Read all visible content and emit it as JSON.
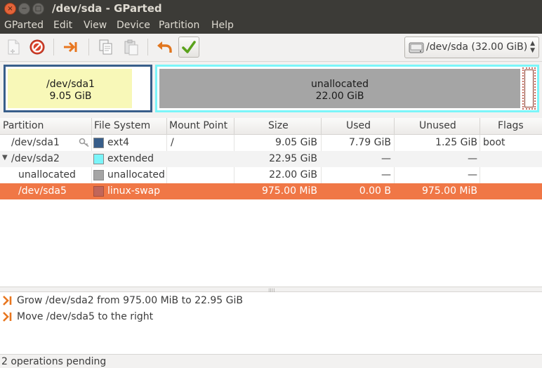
{
  "window": {
    "title": "/dev/sda - GParted"
  },
  "window_controls": {
    "close": "×",
    "minimize": "−",
    "maximize": "□"
  },
  "menu": [
    "GParted",
    "Edit",
    "View",
    "Device",
    "Partition",
    "Help"
  ],
  "device": {
    "label": "/dev/sda  (32.00 GiB)"
  },
  "map": {
    "sda1": {
      "name": "/dev/sda1",
      "size": "9.05 GiB",
      "used_fraction": 0.86
    },
    "unallocated": {
      "name": "unallocated",
      "size": "22.00 GiB"
    }
  },
  "table": {
    "columns": [
      "Partition",
      "File System",
      "Mount Point",
      "Size",
      "Used",
      "Unused",
      "Flags"
    ],
    "rows": [
      {
        "partition": "/dev/sda1",
        "filesystem": "ext4",
        "fs_color": "#385e8a",
        "mount": "/",
        "size": "9.05 GiB",
        "used": "7.79 GiB",
        "unused": "1.25 GiB",
        "flags": "boot"
      },
      {
        "partition": "/dev/sda2",
        "filesystem": "extended",
        "fs_color": "#7bf5f9",
        "mount": "",
        "size": "22.95 GiB",
        "used": "—",
        "unused": "—",
        "flags": ""
      },
      {
        "partition": "unallocated",
        "filesystem": "unallocated",
        "fs_color": "#a5a5a5",
        "mount": "",
        "size": "22.00 GiB",
        "used": "—",
        "unused": "—",
        "flags": ""
      },
      {
        "partition": "/dev/sda5",
        "filesystem": "linux-swap",
        "fs_color": "#c1665a",
        "mount": "",
        "size": "975.00 MiB",
        "used": "0.00 B",
        "unused": "975.00 MiB",
        "flags": ""
      }
    ]
  },
  "operations": [
    "Grow /dev/sda2 from 975.00 MiB to 22.95 GiB",
    "Move /dev/sda5 to the right"
  ],
  "status": "2 operations pending",
  "colors": {
    "selection": "#f07746",
    "ext4": "#385e8a",
    "extended": "#7bf5f9",
    "unallocated": "#a5a5a5",
    "linux_swap": "#c1665a",
    "used_fill": "#f8f8b8"
  },
  "icons": [
    "new-icon",
    "delete-icon",
    "resize-move-icon",
    "copy-icon",
    "paste-icon",
    "undo-icon",
    "apply-icon",
    "harddisk-icon",
    "operation-icon",
    "lock-icon"
  ]
}
